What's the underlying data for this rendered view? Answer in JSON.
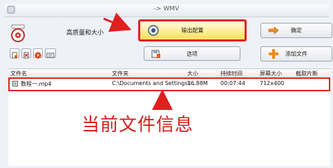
{
  "window": {
    "title": "-> WMV"
  },
  "profile": {
    "label": "高质量和大小"
  },
  "buttons": {
    "output_config": "输出配置",
    "ok": "确定",
    "options": "选项",
    "add_file": "添加文件"
  },
  "table": {
    "columns": [
      "文件名",
      "文件夹",
      "大小",
      "持续时间",
      "屏幕大小",
      "截取片断"
    ],
    "rows": [
      {
        "name": "数程一.mp4",
        "folder": "C:\\Documents and Settings\\...",
        "size": "36.88M",
        "duration": "00:07:44",
        "screen": "712x400",
        "clip": ""
      }
    ]
  },
  "annotation": {
    "text": "当前文件信息"
  },
  "colors": {
    "highlight": "#e01f1f",
    "annotation": "#d3201b",
    "accent": "#ffe15a"
  },
  "icons": [
    "app-icon",
    "profile-icon",
    "gear-icon",
    "play-arrow-icon",
    "options-icon",
    "add-icon",
    "file-icon"
  ]
}
